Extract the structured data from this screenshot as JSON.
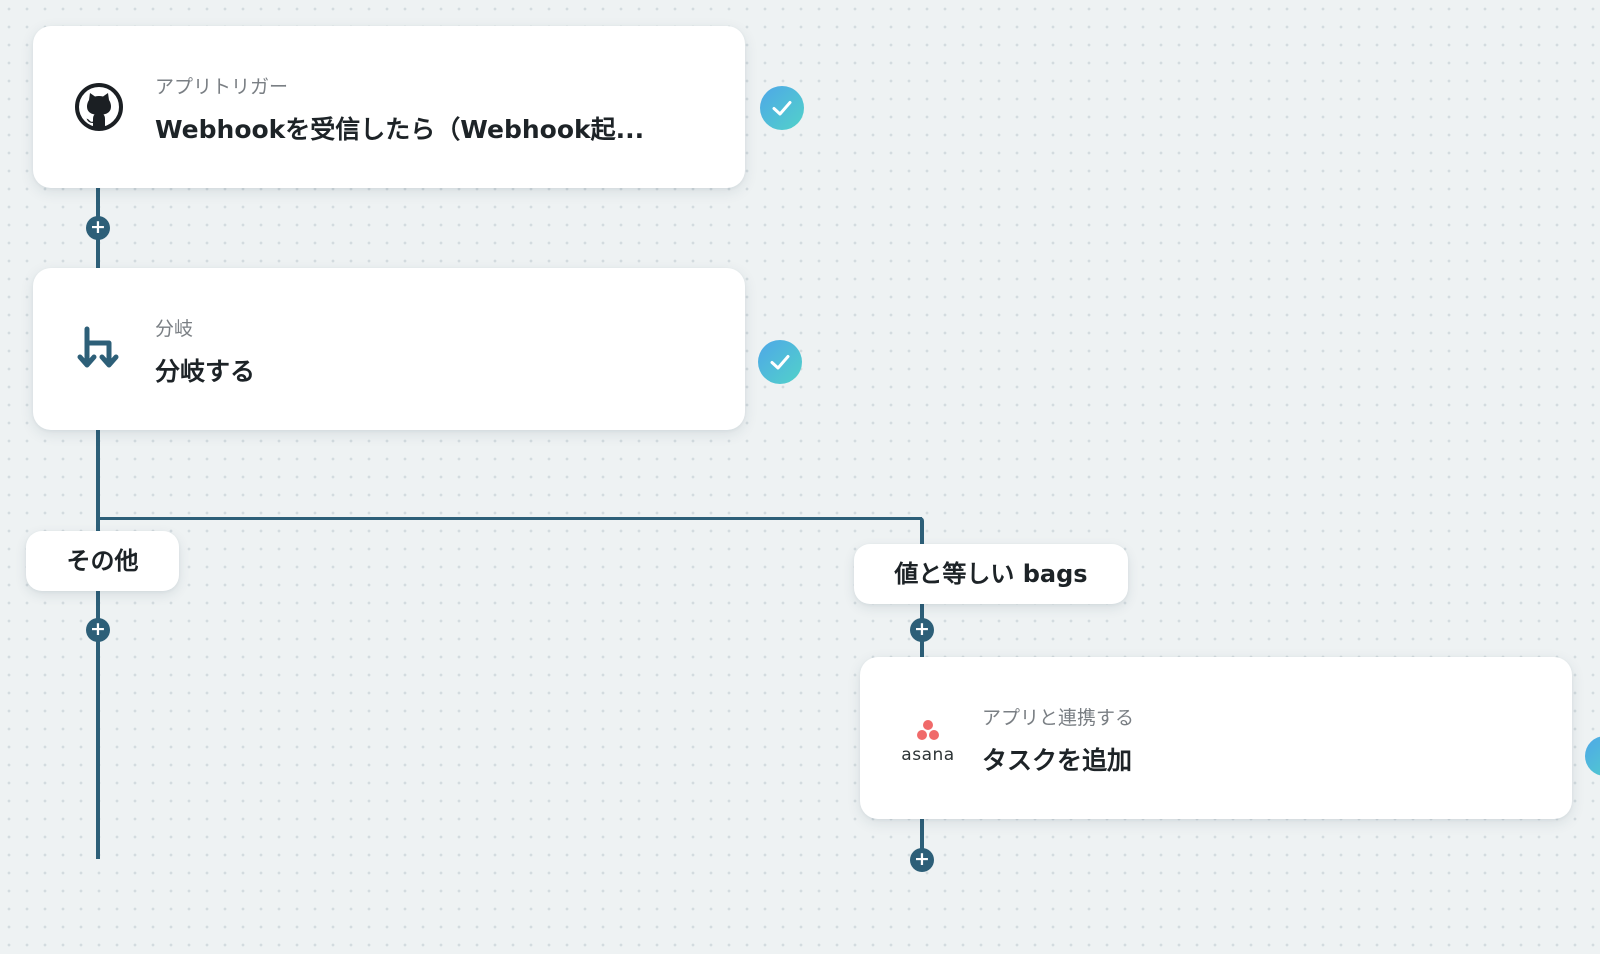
{
  "nodes": [
    {
      "sub": "アプリトリガー",
      "title": "Webhookを受信したら（Webhook起...",
      "icon": "github-icon"
    },
    {
      "sub": "分岐",
      "title": "分岐する",
      "icon": "branch-icon"
    },
    {
      "sub": "アプリと連携する",
      "title": "タスクを追加",
      "icon": "asana-icon",
      "logo_text": "asana"
    }
  ],
  "branches": {
    "left": "その他",
    "right": "値と等しい bags"
  },
  "colors": {
    "connector": "#2d5f78",
    "check_gradient_start": "#4ea7e8",
    "check_gradient_end": "#52d2c9",
    "asana_dots": "#f06a6a"
  }
}
